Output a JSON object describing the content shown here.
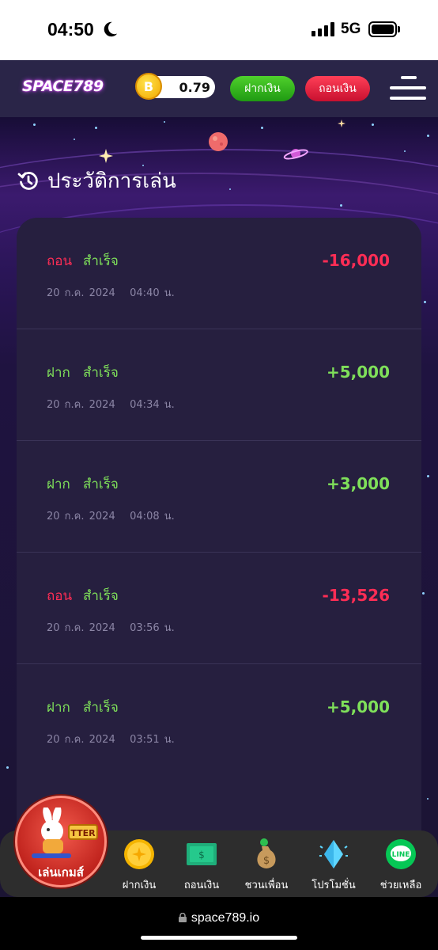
{
  "status_bar": {
    "time": "04:50",
    "network": "5G"
  },
  "header": {
    "logo": "SPACE789",
    "coin_symbol": "B",
    "balance": "0.79",
    "deposit_label": "ฝากเงิน",
    "withdraw_label": "ถอนเงิน"
  },
  "page": {
    "title": "ประวัติการเล่น"
  },
  "history": [
    {
      "type": "ถอน",
      "status": "สำเร็จ",
      "amount": "-16,000",
      "date": "20 ก.ค. 2024",
      "time": "04:40 น."
    },
    {
      "type": "ฝาก",
      "status": "สำเร็จ",
      "amount": "+5,000",
      "date": "20 ก.ค. 2024",
      "time": "04:34 น."
    },
    {
      "type": "ฝาก",
      "status": "สำเร็จ",
      "amount": "+3,000",
      "date": "20 ก.ค. 2024",
      "time": "04:08 น."
    },
    {
      "type": "ถอน",
      "status": "สำเร็จ",
      "amount": "-13,526",
      "date": "20 ก.ค. 2024",
      "time": "03:56 น."
    },
    {
      "type": "ฝาก",
      "status": "สำเร็จ",
      "amount": "+5,000",
      "date": "20 ก.ค. 2024",
      "time": "03:51 น."
    }
  ],
  "bottom_nav": {
    "play_label": "เล่นเกมส์",
    "play_game_logo": "TTER",
    "items": [
      {
        "label": "ฝากเงิน",
        "icon": "coin-icon"
      },
      {
        "label": "ถอนเงิน",
        "icon": "banknote-icon"
      },
      {
        "label": "ชวนเพื่อน",
        "icon": "money-bag-icon"
      },
      {
        "label": "โปรโมชั่น",
        "icon": "diamond-icon"
      },
      {
        "label": "ช่วยเหลือ",
        "icon": "line-chat-icon"
      }
    ],
    "line_badge": "LINE"
  },
  "browser": {
    "url": "space789.io"
  },
  "colors": {
    "negative": "#ff2d55",
    "positive": "#7fe05a",
    "card": "#261f3f",
    "header": "#2a2548"
  }
}
